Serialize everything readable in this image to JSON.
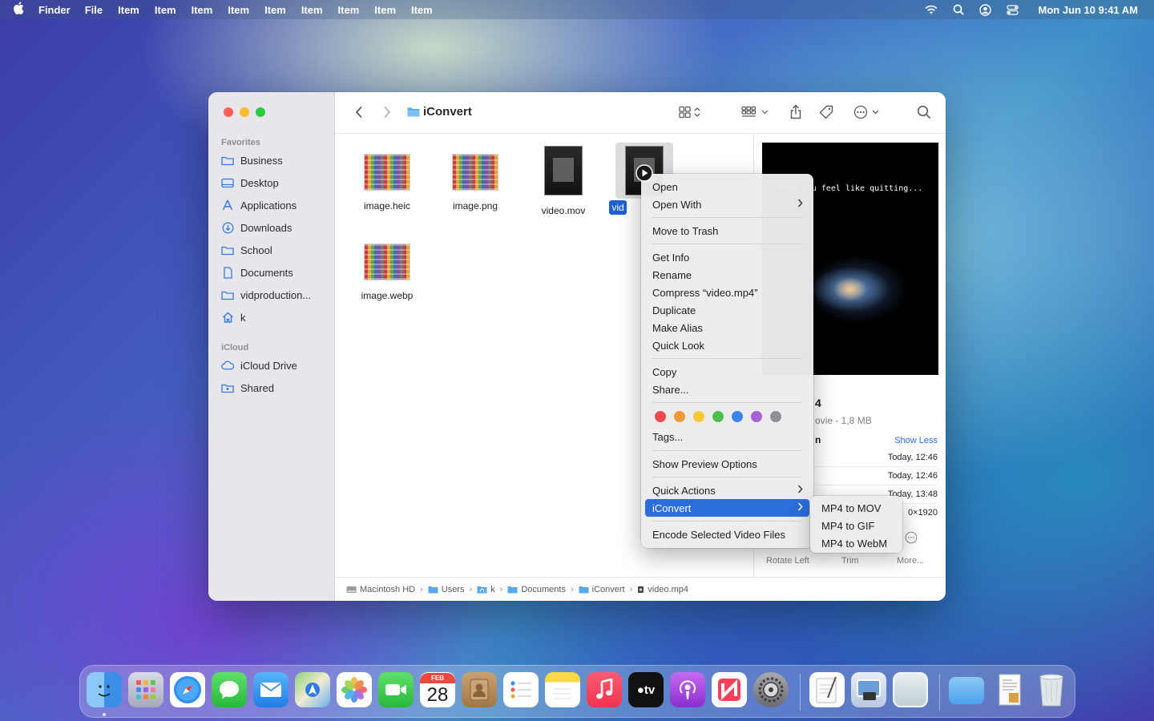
{
  "menubar": {
    "app": "Finder",
    "items": [
      "File",
      "Item",
      "Item",
      "Item",
      "Item",
      "Item",
      "Item",
      "Item",
      "Item",
      "Item"
    ],
    "clock": "Mon Jun 10  9:41 AM"
  },
  "window": {
    "title": "iConvert",
    "sidebar": {
      "favorites_label": "Favorites",
      "favorites": [
        {
          "label": "Business",
          "icon": "folder-icon"
        },
        {
          "label": "Desktop",
          "icon": "desktop-icon"
        },
        {
          "label": "Applications",
          "icon": "applications-icon"
        },
        {
          "label": "Downloads",
          "icon": "downloads-icon"
        },
        {
          "label": "School",
          "icon": "folder-icon"
        },
        {
          "label": "Documents",
          "icon": "document-icon"
        },
        {
          "label": "vidproduction...",
          "icon": "folder-icon"
        },
        {
          "label": "k",
          "icon": "home-icon"
        }
      ],
      "icloud_label": "iCloud",
      "icloud": [
        {
          "label": "iCloud Drive",
          "icon": "cloud-icon"
        },
        {
          "label": "Shared",
          "icon": "shared-folder-icon"
        }
      ]
    },
    "files": [
      {
        "name": "image.heic",
        "kind": "image"
      },
      {
        "name": "image.png",
        "kind": "image"
      },
      {
        "name": "video.mov",
        "kind": "video"
      },
      {
        "name": "vid",
        "kind": "video",
        "selected": true
      },
      {
        "name": "image.webp",
        "kind": "image"
      }
    ],
    "preview": {
      "video_caption": "When you feel like quitting...",
      "title": "4",
      "subtitle": "ovie - 1,8 MB",
      "info_label": "n",
      "show_less": "Show Less",
      "rows": [
        "Today, 12:46",
        "Today, 12:46",
        "Today, 13:48",
        "0×1920"
      ],
      "actions": [
        "Rotate Left",
        "Trim",
        "More..."
      ]
    },
    "pathbar": [
      "Macintosh HD",
      "Users",
      "k",
      "Documents",
      "iConvert",
      "video.mp4"
    ]
  },
  "context_menu": {
    "items": [
      {
        "label": "Open"
      },
      {
        "label": "Open With",
        "submenu": true
      },
      {
        "label": "Move to Trash"
      },
      {
        "label": "Get Info"
      },
      {
        "label": "Rename"
      },
      {
        "label": "Compress “video.mp4”"
      },
      {
        "label": "Duplicate"
      },
      {
        "label": "Make Alias"
      },
      {
        "label": "Quick Look"
      },
      {
        "label": "Copy"
      },
      {
        "label": "Share..."
      },
      {
        "label": "Tags..."
      },
      {
        "label": "Show Preview Options"
      },
      {
        "label": "Quick Actions",
        "submenu": true
      },
      {
        "label": "iConvert",
        "submenu": true,
        "highlighted": true
      },
      {
        "label": "Encode Selected Video Files"
      }
    ],
    "tag_colors": [
      "#ec4b4b",
      "#f29a38",
      "#f5c93b",
      "#4cc04f",
      "#3a83f0",
      "#a761d6",
      "#8e8e93"
    ]
  },
  "submenu": {
    "items": [
      "MP4 to MOV",
      "MP4 to GIF",
      "MP4 to WebM"
    ]
  },
  "dock": {
    "calendar_month": "FEB",
    "calendar_day": "28",
    "tv_label": "●tv",
    "apps": [
      "finder-icon",
      "launchpad-icon",
      "safari-icon",
      "messages-icon",
      "mail-icon",
      "maps-icon",
      "photos-icon",
      "facetime-icon",
      "calendar-icon",
      "contacts-icon",
      "reminders-icon",
      "notes-icon",
      "music-icon",
      "tv-icon",
      "podcasts-icon",
      "news-icon",
      "system-settings-icon",
      "textedit-icon",
      "preview-icon",
      "blank-app-icon",
      "downloads-folder-icon",
      "document-stack-icon",
      "trash-icon"
    ]
  }
}
